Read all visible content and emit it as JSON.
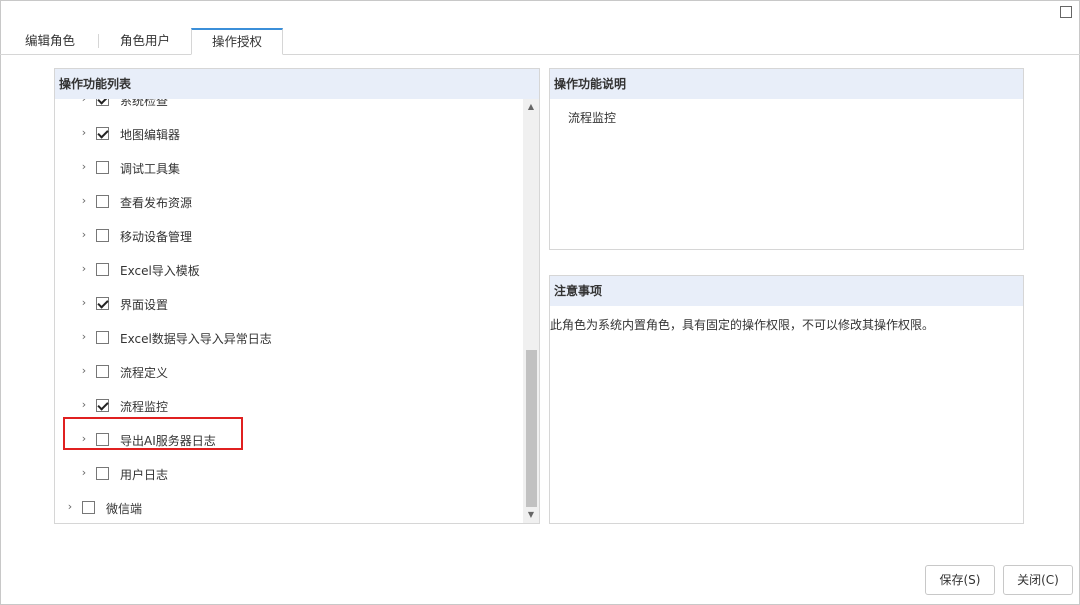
{
  "tabs": [
    {
      "label": "编辑角色"
    },
    {
      "label": "角色用户"
    },
    {
      "label": "操作授权",
      "active": true
    }
  ],
  "left_panel": {
    "title": "操作功能列表",
    "items": [
      {
        "label": "系统检查",
        "checked": true,
        "level": 2
      },
      {
        "label": "地图编辑器",
        "checked": true,
        "level": 2
      },
      {
        "label": "调试工具集",
        "checked": false,
        "level": 2
      },
      {
        "label": "查看发布资源",
        "checked": false,
        "level": 2
      },
      {
        "label": "移动设备管理",
        "checked": false,
        "level": 2
      },
      {
        "label": "Excel导入模板",
        "checked": false,
        "level": 2
      },
      {
        "label": "界面设置",
        "checked": true,
        "level": 2
      },
      {
        "label": "Excel数据导入导入异常日志",
        "checked": false,
        "level": 2
      },
      {
        "label": "流程定义",
        "checked": false,
        "level": 2
      },
      {
        "label": "流程监控",
        "checked": true,
        "level": 2,
        "highlighted": true
      },
      {
        "label": "导出AI服务器日志",
        "checked": false,
        "level": 2
      },
      {
        "label": "用户日志",
        "checked": false,
        "level": 2
      },
      {
        "label": "微信端",
        "checked": false,
        "level": 1
      }
    ]
  },
  "description_panel": {
    "title": "操作功能说明",
    "text": "流程监控"
  },
  "notes_panel": {
    "title": "注意事项",
    "text": "此角色为系统内置角色，具有固定的操作权限，不可以修改其操作权限。"
  },
  "buttons": {
    "save": "保存(S)",
    "close": "关闭(C)"
  },
  "colors": {
    "panel_header_bg": "#e8eef9",
    "active_tab_accent": "#3b8fd9",
    "highlight_border": "#e02020"
  }
}
